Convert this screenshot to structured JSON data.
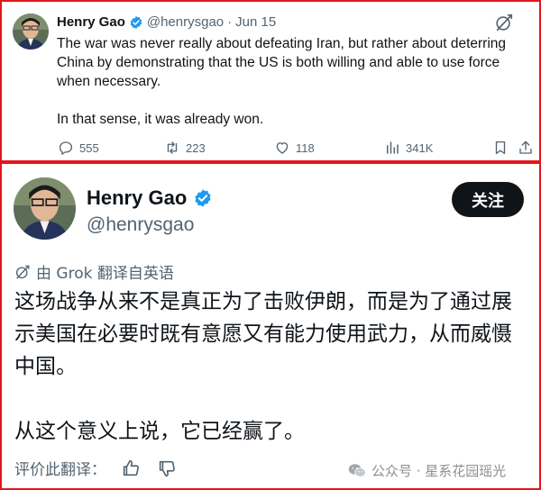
{
  "tweet": {
    "author_name": "Henry Gao",
    "handle": "@henrysgao",
    "separator": "·",
    "date": "Jun 15",
    "paragraphs": [
      "The war was never really about defeating Iran, but rather about deterring China by demonstrating that the US is both willing and able to use force when necessary.",
      "In that sense, it was already won."
    ],
    "actions": {
      "replies": "555",
      "reposts": "223",
      "likes": "118",
      "views": "341K"
    }
  },
  "translation": {
    "author_name": "Henry Gao",
    "handle": "@henrysgao",
    "follow_label": "关注",
    "translated_by": "由 Grok 翻译自英语",
    "paragraphs": [
      "这场战争从来不是真正为了击败伊朗，而是为了通过展示美国在必要时既有意愿又有能力使用武力，从而威慑中国。",
      "从这个意义上说，它已经赢了。"
    ],
    "rate_label": "评价此翻译："
  },
  "watermark": {
    "text": "公众号 · 星系花园瑶光"
  },
  "icons": {
    "verified": "verified-badge-icon",
    "grok": "grok-icon",
    "reply": "reply-icon",
    "repost": "repost-icon",
    "like": "heart-icon",
    "views": "views-icon",
    "bookmark": "bookmark-icon",
    "share": "share-icon",
    "thumbs_up": "thumbs-up-icon",
    "thumbs_down": "thumbs-down-icon",
    "wechat": "wechat-icon"
  },
  "colors": {
    "verified_blue": "#1d9bf0",
    "border_red": "#e5161d",
    "text_primary": "#0f1419",
    "text_secondary": "#536471",
    "follow_button_bg": "#0f1419"
  }
}
